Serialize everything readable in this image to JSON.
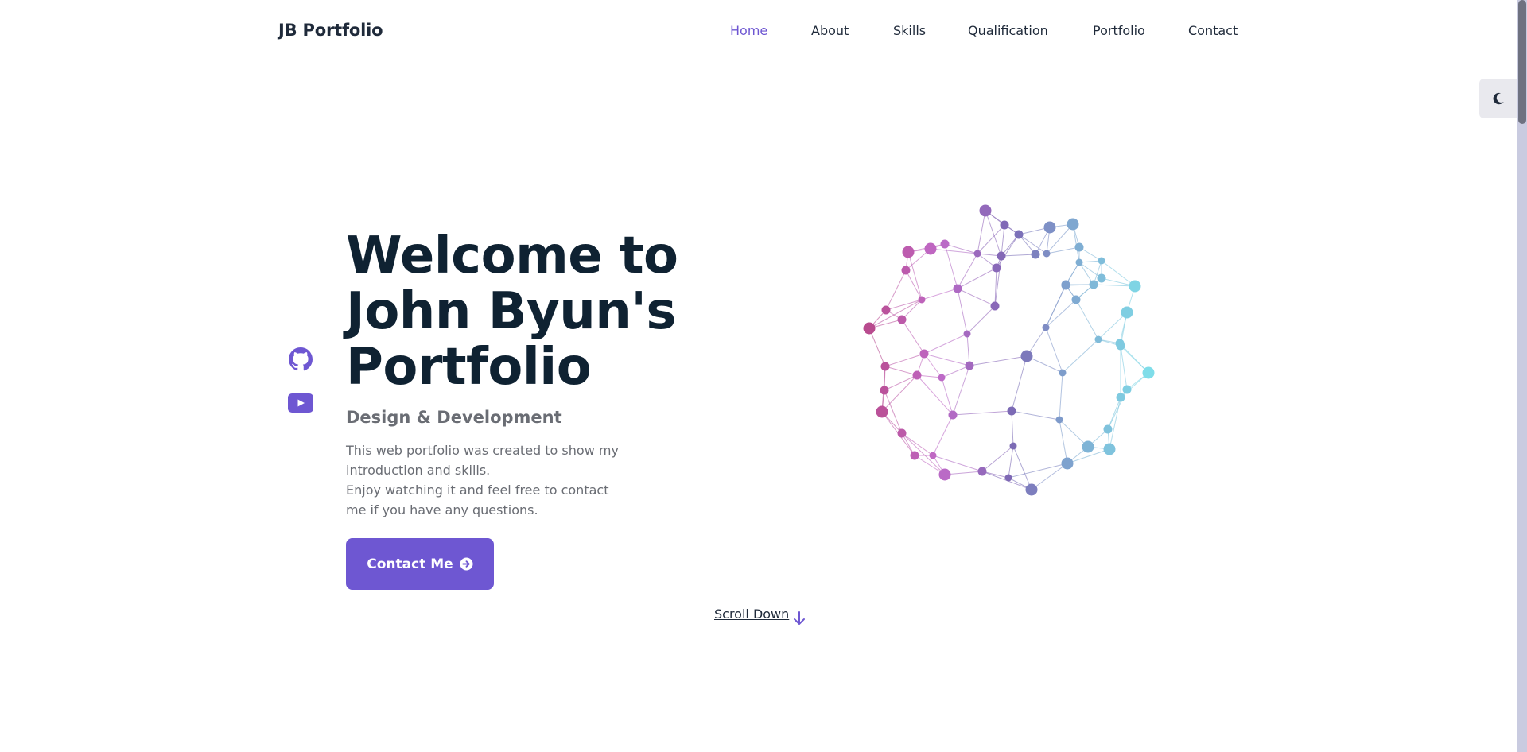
{
  "header": {
    "logo": "JB Portfolio",
    "nav": [
      {
        "label": "Home",
        "active": true
      },
      {
        "label": "About",
        "active": false
      },
      {
        "label": "Skills",
        "active": false
      },
      {
        "label": "Qualification",
        "active": false
      },
      {
        "label": "Portfolio",
        "active": false
      },
      {
        "label": "Contact",
        "active": false
      }
    ]
  },
  "theme_toggle": {
    "icon": "moon-icon"
  },
  "social": [
    {
      "icon": "github-icon"
    },
    {
      "icon": "youtube-icon"
    }
  ],
  "hero": {
    "title_lines": [
      "Welcome to",
      "John Byun's",
      "Portfolio"
    ],
    "subtitle": "Design & Development",
    "description": [
      "This web portfolio was created to show my introduction and skills.",
      "Enjoy watching it and feel free to contact me if you have any questions."
    ],
    "cta_label": "Contact Me",
    "cta_icon": "arrow-circle-right-icon"
  },
  "scroll_down": {
    "label": "Scroll Down",
    "icon": "arrow-down-icon"
  },
  "colors": {
    "accent": "#6e57d2",
    "title": "#0f2232",
    "text": "#1f2a3a",
    "muted": "#6a6d74",
    "sphere_left": "#b84a8c",
    "sphere_mid": "#7c68b4",
    "sphere_right": "#7fe0ea"
  }
}
